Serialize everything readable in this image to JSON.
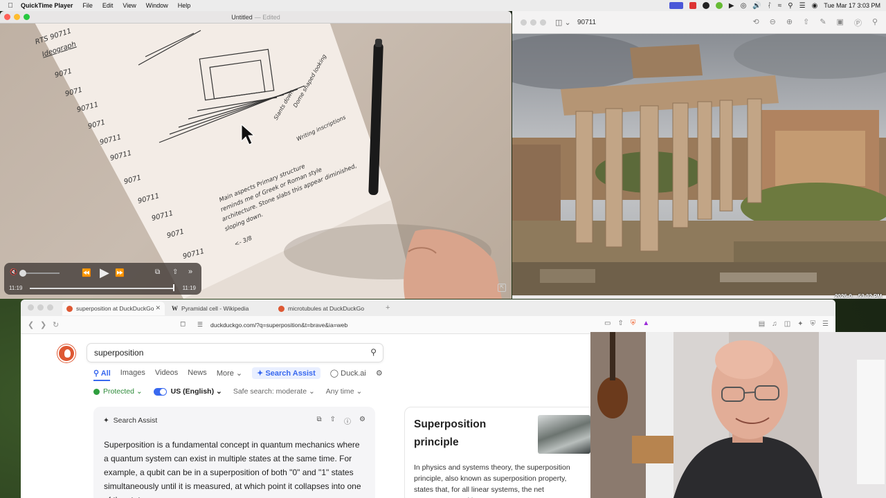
{
  "menubar": {
    "app_name": "QuickTime Player",
    "menus": [
      "File",
      "Edit",
      "View",
      "Window",
      "Help"
    ],
    "clock": "Tue Mar 17  3:03 PM"
  },
  "quicktime": {
    "title": "Untitled",
    "title_suffix": "— Edited",
    "time_current": "11:19",
    "time_total": "11:19",
    "progress": 1.0,
    "sketch_notes": {
      "top_left": "RTS 90711",
      "ideograph": "Ideograph",
      "codes": [
        "9071",
        "9071",
        "90711",
        "9071",
        "90711",
        "90711",
        "9071",
        "90711",
        "90711",
        "9071",
        "90711"
      ],
      "side_notes": [
        "Slants down",
        "Dome shaped looking",
        "Writing inscriptions"
      ],
      "main_aspects": "Main aspects Primary structure",
      "reminds": "reminds me of Greek or Roman style",
      "architecture": "architecture. Stone slabs this appear diminished,",
      "sloping": "sloping down.",
      "arrow": "<- 3/8"
    }
  },
  "preview": {
    "doc_name": "90711",
    "caption": "2026-0....53.32 PM"
  },
  "browser": {
    "tabs": [
      {
        "label": "superposition at DuckDuckGo",
        "active": true,
        "icon": "duckduckgo-icon"
      },
      {
        "label": "Pyramidal cell - Wikipedia",
        "active": false,
        "icon": "wikipedia-icon"
      },
      {
        "label": "microtubules at DuckDuckGo",
        "active": false,
        "icon": "duckduckgo-icon"
      }
    ],
    "wiki_glyph": "W",
    "url": "duckduckgo.com/?q=superposition&t=brave&ia=web",
    "search_query": "superposition",
    "nav_tabs": {
      "all": "All",
      "images": "Images",
      "videos": "Videos",
      "news": "News",
      "more": "More",
      "search_assist": "Search Assist",
      "duck_ai": "Duck.ai"
    },
    "filters": {
      "protected": "Protected",
      "region": "US (English)",
      "safe_search": "Safe search: moderate",
      "any_time": "Any time"
    },
    "assist": {
      "header": "Search Assist",
      "body": "Superposition is a fundamental concept in quantum mechanics where a quantum system can exist in multiple states at the same time. For example, a qubit can be in a superposition of both \"0\" and \"1\" states simultaneously until it is measured, at which point it collapses into one of the states."
    },
    "knowledge_panel": {
      "title": "Superposition principle",
      "text": "In physics and systems theory, the superposition principle, also known as superposition property, states that, for all linear systems, the net response caused by two or more"
    }
  },
  "colors": {
    "ddg_orange": "#de5833",
    "ddg_blue": "#3969ef",
    "protected_green": "#2e8b3a"
  }
}
